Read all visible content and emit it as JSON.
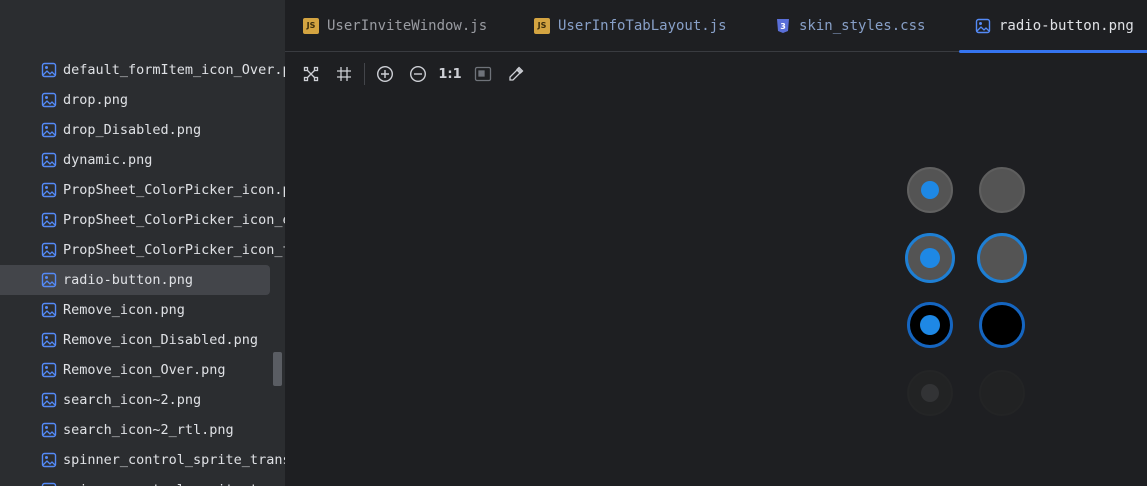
{
  "sidebar": {
    "files": [
      {
        "label": "default_formItem_icon_Over.png",
        "selected": false
      },
      {
        "label": "drop.png",
        "selected": false
      },
      {
        "label": "drop_Disabled.png",
        "selected": false
      },
      {
        "label": "dynamic.png",
        "selected": false
      },
      {
        "label": "PropSheet_ColorPicker_icon.png",
        "selected": false
      },
      {
        "label": "PropSheet_ColorPicker_icon_e",
        "selected": false
      },
      {
        "label": "PropSheet_ColorPicker_icon_t",
        "selected": false
      },
      {
        "label": "radio-button.png",
        "selected": true
      },
      {
        "label": "Remove_icon.png",
        "selected": false
      },
      {
        "label": "Remove_icon_Disabled.png",
        "selected": false
      },
      {
        "label": "Remove_icon_Over.png",
        "selected": false
      },
      {
        "label": "search_icon~2.png",
        "selected": false
      },
      {
        "label": "search_icon~2_rtl.png",
        "selected": false
      },
      {
        "label": "spinner_control_sprite_trans",
        "selected": false
      },
      {
        "label": "spinner_control_sprite_t",
        "selected": false
      }
    ]
  },
  "tabs": [
    {
      "label": "UserInviteWindow.js",
      "icon": "js-file-icon"
    },
    {
      "label": "UserInfoTabLayout.js",
      "icon": "js-file-icon"
    },
    {
      "label": "skin_styles.css",
      "icon": "css-file-icon"
    },
    {
      "label": "radio-button.png",
      "icon": "image-file-icon",
      "active": true
    }
  ],
  "toolbar": {
    "actual_size_label": "1:1",
    "icons": [
      "fit-to-window-icon",
      "grid-icon",
      "zoom-in-icon",
      "zoom-out-icon",
      "actual-size-icon",
      "background-toggle-icon",
      "color-picker-icon"
    ]
  },
  "colors": {
    "accent": "#3574f0",
    "radio_blue": "#1e88e5",
    "radio_gray": "#545454",
    "radio_ring": "#1565c0"
  }
}
